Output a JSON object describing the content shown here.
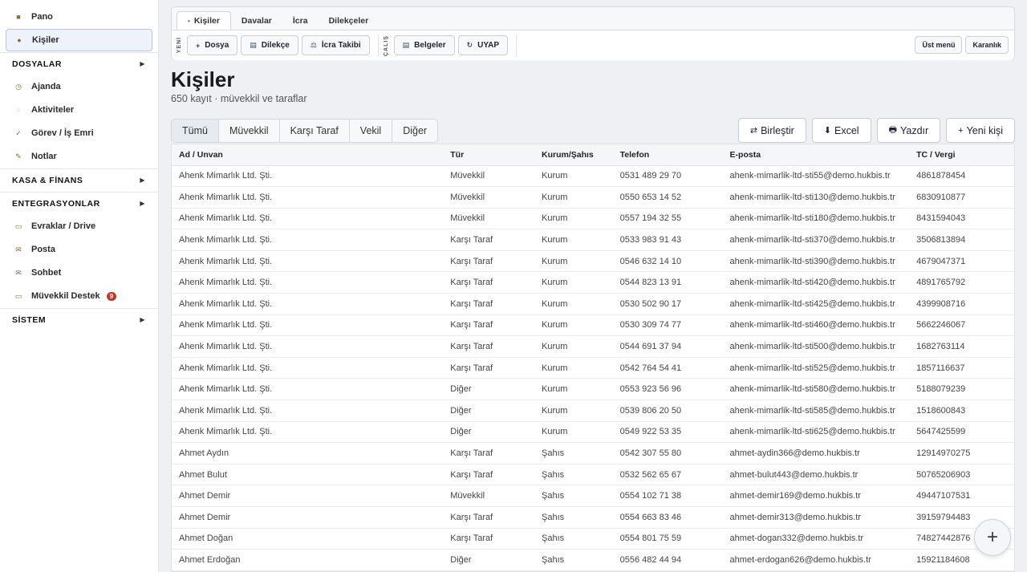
{
  "sidebar": {
    "items": [
      {
        "type": "item",
        "label": "Pano",
        "icon": "dashboard-icon",
        "glyph": "■",
        "active": false
      },
      {
        "type": "item",
        "label": "Kişiler",
        "icon": "contacts-icon",
        "glyph": "●",
        "active": true
      },
      {
        "type": "section",
        "label": "DOSYALAR"
      },
      {
        "type": "item",
        "label": "Ajanda",
        "icon": "clock-icon",
        "glyph": "◷",
        "active": false
      },
      {
        "type": "item",
        "label": "Aktiviteler",
        "icon": "activity-icon",
        "glyph": "◌",
        "active": false
      },
      {
        "type": "item",
        "label": "Görev / İş Emri",
        "icon": "check-icon",
        "glyph": "✓",
        "active": false
      },
      {
        "type": "item",
        "label": "Notlar",
        "icon": "pencil-icon",
        "glyph": "✎",
        "active": false
      },
      {
        "type": "section",
        "label": "KASA & FİNANS"
      },
      {
        "type": "section",
        "label": "ENTEGRASYONLAR"
      },
      {
        "type": "item",
        "label": "Evraklar / Drive",
        "icon": "folder-icon",
        "glyph": "▭",
        "active": false
      },
      {
        "type": "item",
        "label": "Posta",
        "icon": "mail-icon",
        "glyph": "✉",
        "active": false
      },
      {
        "type": "item",
        "label": "Sohbet",
        "icon": "chat-icon",
        "glyph": "✉",
        "active": false
      },
      {
        "type": "item",
        "label": "Müvekkil Destek",
        "icon": "support-icon",
        "glyph": "▭",
        "active": false,
        "badge": "9"
      },
      {
        "type": "section",
        "label": "SİSTEM"
      }
    ]
  },
  "topbar": {
    "tabs": [
      {
        "label": "Kişiler",
        "active": true
      },
      {
        "label": "Davalar",
        "active": false
      },
      {
        "label": "İcra",
        "active": false
      },
      {
        "label": "Dilekçeler",
        "active": false
      }
    ],
    "new_label": "YENİ",
    "work_label": "ÇALIŞ",
    "new_buttons": [
      {
        "label": "Dosya",
        "glyph": "+",
        "icon": "plus-icon"
      },
      {
        "label": "Dilekçe",
        "glyph": "▤",
        "icon": "document-icon"
      },
      {
        "label": "İcra Takibi",
        "glyph": "⚖",
        "icon": "scales-icon"
      }
    ],
    "work_buttons": [
      {
        "label": "Belgeler",
        "glyph": "▤",
        "icon": "documents-icon"
      },
      {
        "label": "UYAP",
        "glyph": "↻",
        "icon": "refresh-icon"
      }
    ],
    "right_buttons": [
      "Üst menü",
      "Karanlık"
    ]
  },
  "page": {
    "title": "Kişiler",
    "subtitle": "650 kayıt · müvekkil ve taraflar"
  },
  "filters": [
    {
      "label": "Tümü",
      "active": true
    },
    {
      "label": "Müvekkil",
      "active": false
    },
    {
      "label": "Karşı Taraf",
      "active": false
    },
    {
      "label": "Vekil",
      "active": false
    },
    {
      "label": "Diğer",
      "active": false
    }
  ],
  "actions": [
    {
      "label": "Birleştir",
      "glyph": "⇄",
      "icon": "merge-icon",
      "name": "merge-button"
    },
    {
      "label": "Excel",
      "glyph": "⬇",
      "icon": "download-icon",
      "name": "excel-button"
    },
    {
      "label": "Yazdır",
      "glyph": "🖶",
      "icon": "print-icon",
      "name": "print-button"
    },
    {
      "label": "Yeni kişi",
      "glyph": "+",
      "icon": "plus-icon",
      "name": "new-contact-button"
    }
  ],
  "table": {
    "columns": [
      "Ad / Unvan",
      "Tür",
      "Kurum/Şahıs",
      "Telefon",
      "E-posta",
      "TC / Vergi"
    ],
    "rows": [
      [
        "Ahenk Mimarlık Ltd. Şti.",
        "Müvekkil",
        "Kurum",
        "0531 489 29 70",
        "ahenk-mimarlik-ltd-sti55@demo.hukbis.tr",
        "4861878454"
      ],
      [
        "Ahenk Mimarlık Ltd. Şti.",
        "Müvekkil",
        "Kurum",
        "0550 653 14 52",
        "ahenk-mimarlik-ltd-sti130@demo.hukbis.tr",
        "6830910877"
      ],
      [
        "Ahenk Mimarlık Ltd. Şti.",
        "Müvekkil",
        "Kurum",
        "0557 194 32 55",
        "ahenk-mimarlik-ltd-sti180@demo.hukbis.tr",
        "8431594043"
      ],
      [
        "Ahenk Mimarlık Ltd. Şti.",
        "Karşı Taraf",
        "Kurum",
        "0533 983 91 43",
        "ahenk-mimarlik-ltd-sti370@demo.hukbis.tr",
        "3506813894"
      ],
      [
        "Ahenk Mimarlık Ltd. Şti.",
        "Karşı Taraf",
        "Kurum",
        "0546 632 14 10",
        "ahenk-mimarlik-ltd-sti390@demo.hukbis.tr",
        "4679047371"
      ],
      [
        "Ahenk Mimarlık Ltd. Şti.",
        "Karşı Taraf",
        "Kurum",
        "0544 823 13 91",
        "ahenk-mimarlik-ltd-sti420@demo.hukbis.tr",
        "4891765792"
      ],
      [
        "Ahenk Mimarlık Ltd. Şti.",
        "Karşı Taraf",
        "Kurum",
        "0530 502 90 17",
        "ahenk-mimarlik-ltd-sti425@demo.hukbis.tr",
        "4399908716"
      ],
      [
        "Ahenk Mimarlık Ltd. Şti.",
        "Karşı Taraf",
        "Kurum",
        "0530 309 74 77",
        "ahenk-mimarlik-ltd-sti460@demo.hukbis.tr",
        "5662246067"
      ],
      [
        "Ahenk Mimarlık Ltd. Şti.",
        "Karşı Taraf",
        "Kurum",
        "0544 691 37 94",
        "ahenk-mimarlik-ltd-sti500@demo.hukbis.tr",
        "1682763114"
      ],
      [
        "Ahenk Mimarlık Ltd. Şti.",
        "Karşı Taraf",
        "Kurum",
        "0542 764 54 41",
        "ahenk-mimarlik-ltd-sti525@demo.hukbis.tr",
        "1857116637"
      ],
      [
        "Ahenk Mimarlık Ltd. Şti.",
        "Diğer",
        "Kurum",
        "0553 923 56 96",
        "ahenk-mimarlik-ltd-sti580@demo.hukbis.tr",
        "5188079239"
      ],
      [
        "Ahenk Mimarlık Ltd. Şti.",
        "Diğer",
        "Kurum",
        "0539 806 20 50",
        "ahenk-mimarlik-ltd-sti585@demo.hukbis.tr",
        "1518600843"
      ],
      [
        "Ahenk Mimarlık Ltd. Şti.",
        "Diğer",
        "Kurum",
        "0549 922 53 35",
        "ahenk-mimarlik-ltd-sti625@demo.hukbis.tr",
        "5647425599"
      ],
      [
        "Ahmet Aydın",
        "Karşı Taraf",
        "Şahıs",
        "0542 307 55 80",
        "ahmet-aydin366@demo.hukbis.tr",
        "12914970275"
      ],
      [
        "Ahmet Bulut",
        "Karşı Taraf",
        "Şahıs",
        "0532 562 65 67",
        "ahmet-bulut443@demo.hukbis.tr",
        "50765206903"
      ],
      [
        "Ahmet Demir",
        "Müvekkil",
        "Şahıs",
        "0554 102 71 38",
        "ahmet-demir169@demo.hukbis.tr",
        "49447107531"
      ],
      [
        "Ahmet Demir",
        "Karşı Taraf",
        "Şahıs",
        "0554 663 83 46",
        "ahmet-demir313@demo.hukbis.tr",
        "39159794483"
      ],
      [
        "Ahmet Doğan",
        "Karşı Taraf",
        "Şahıs",
        "0554 801 75 59",
        "ahmet-dogan332@demo.hukbis.tr",
        "74827442876"
      ],
      [
        "Ahmet Erdoğan",
        "Diğer",
        "Şahıs",
        "0556 482 44 94",
        "ahmet-erdogan626@demo.hukbis.tr",
        "15921184608"
      ]
    ]
  },
  "fab": {
    "glyph": "+",
    "icon": "plus-icon"
  }
}
